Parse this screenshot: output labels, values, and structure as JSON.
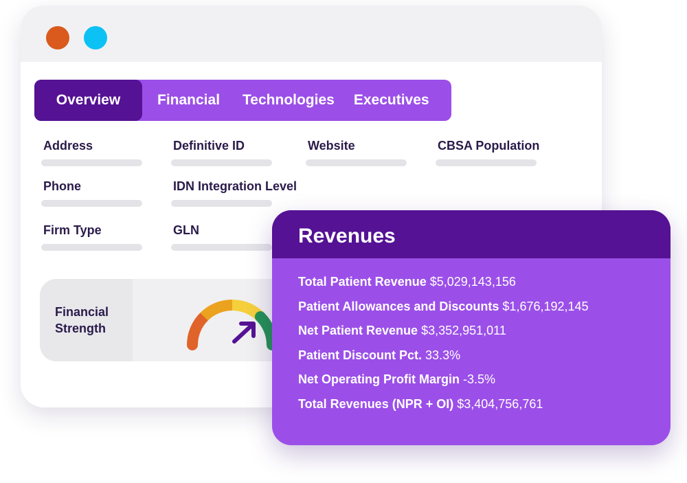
{
  "tabs": [
    {
      "label": "Overview",
      "active": true
    },
    {
      "label": "Financial",
      "active": false
    },
    {
      "label": "Technologies",
      "active": false
    },
    {
      "label": "Executives",
      "active": false
    }
  ],
  "fields": {
    "address": "Address",
    "definitive_id": "Definitive ID",
    "website": "Website",
    "cbsa_population": "CBSA Population",
    "phone": "Phone",
    "idn_integration_level": "IDN Integration Level",
    "firm_type": "Firm Type",
    "gln": "GLN"
  },
  "financial_strength": {
    "label_line1": "Financial",
    "label_line2": "Strength",
    "gauge_colors": [
      "#e0632a",
      "#eba21f",
      "#f5cf3c",
      "#239155"
    ],
    "needle_color": "#551294"
  },
  "revenues": {
    "title": "Revenues",
    "rows": [
      {
        "label": "Total Patient Revenue",
        "value": "$5,029,143,156"
      },
      {
        "label": "Patient Allowances and Discounts",
        "value": "$1,676,192,145"
      },
      {
        "label": "Net Patient Revenue",
        "value": "$3,352,951,011"
      },
      {
        "label": "Patient Discount Pct.",
        "value": "33.3%"
      },
      {
        "label": "Net Operating Profit Margin",
        "value": "-3.5%"
      },
      {
        "label": "Total Revenues (NPR + OI)",
        "value": "$3,404,756,761"
      }
    ]
  },
  "colors": {
    "accent_dark": "#551294",
    "accent": "#9b4fe8",
    "dot_orange": "#d95a1c",
    "dot_blue": "#0cc1f3"
  }
}
